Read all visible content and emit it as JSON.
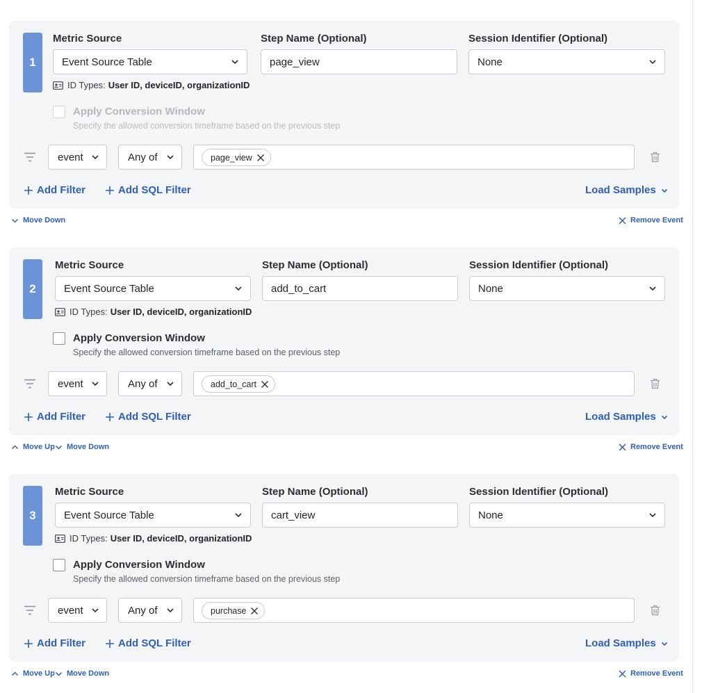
{
  "labels": {
    "metric_source": "Metric Source",
    "step_name": "Step Name (Optional)",
    "session_identifier": "Session Identifier (Optional)",
    "id_types_prefix": "ID Types:",
    "apply_conversion": "Apply Conversion Window",
    "conversion_sub": "Specify the allowed conversion timeframe based on the previous step",
    "add_filter": "Add Filter",
    "add_sql_filter": "Add SQL Filter",
    "load_samples": "Load Samples",
    "move_up": "Move Up",
    "move_down": "Move Down",
    "remove_event": "Remove Event"
  },
  "colors": {
    "badge": "#6a93d8",
    "link": "#2f5fb3",
    "card_bg": "#f4f5f7",
    "border": "#c9cdd3"
  },
  "steps": [
    {
      "number": "1",
      "metric_source": "Event Source Table",
      "step_name": "page_view",
      "session_identifier": "None",
      "id_types": "User ID, deviceID, organizationID",
      "conversion_window_enabled": false,
      "filter_field": "event",
      "filter_operator": "Any of",
      "filter_values": [
        "page_view"
      ]
    },
    {
      "number": "2",
      "metric_source": "Event Source Table",
      "step_name": "add_to_cart",
      "session_identifier": "None",
      "id_types": "User ID, deviceID, organizationID",
      "conversion_window_enabled": true,
      "filter_field": "event",
      "filter_operator": "Any of",
      "filter_values": [
        "add_to_cart"
      ]
    },
    {
      "number": "3",
      "metric_source": "Event Source Table",
      "step_name": "cart_view",
      "session_identifier": "None",
      "id_types": "User ID, deviceID, organizationID",
      "conversion_window_enabled": true,
      "filter_field": "event",
      "filter_operator": "Any of",
      "filter_values": [
        "purchase"
      ]
    }
  ],
  "icons": {
    "chevron": "chevron-down-icon",
    "id_card": "id-card-icon",
    "filter": "filter-lines-icon",
    "trash": "trash-icon",
    "plus": "plus-icon",
    "close": "close-icon",
    "chevron_up": "chevron-up-icon"
  }
}
